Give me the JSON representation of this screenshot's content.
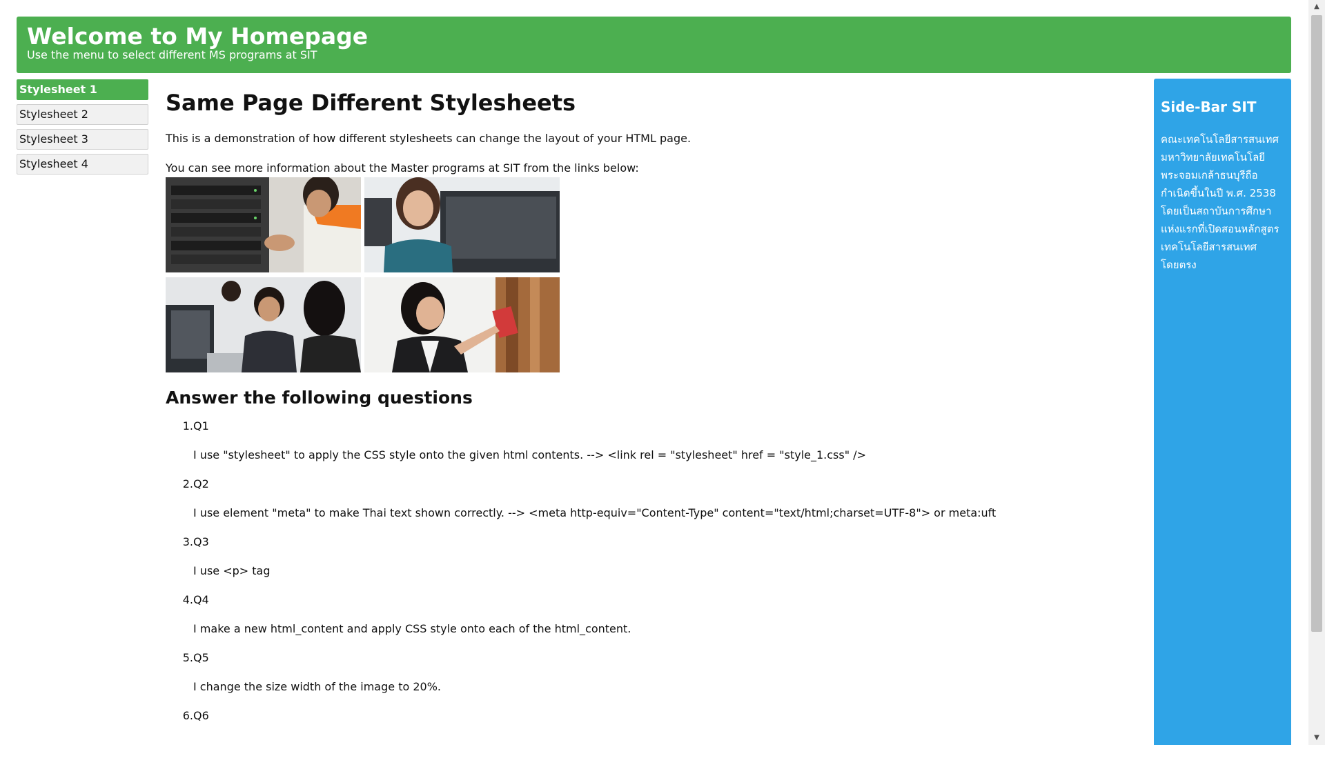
{
  "header": {
    "title": "Welcome to My Homepage",
    "subtitle": "Use the menu to select different MS programs at SIT"
  },
  "menu": {
    "items": [
      {
        "label": "Stylesheet 1",
        "active": true
      },
      {
        "label": "Stylesheet 2",
        "active": false
      },
      {
        "label": "Stylesheet 3",
        "active": false
      },
      {
        "label": "Stylesheet 4",
        "active": false
      }
    ]
  },
  "main": {
    "title": "Same Page Different Stylesheets",
    "intro": "This is a demonstration of how different stylesheets can change the layout of your HTML page.",
    "links_text": "You can see more information about the Master programs at SIT from the links below:",
    "gallery": [
      {
        "icon": "photo-server-technician-icon"
      },
      {
        "icon": "photo-woman-computer-icon"
      },
      {
        "icon": "photo-students-computer-lab-icon"
      },
      {
        "icon": "photo-woman-bookshelf-icon"
      }
    ],
    "questions_title": "Answer the following questions",
    "questions": [
      {
        "num": "1.",
        "q": "Q1",
        "a": "I use \"stylesheet\" to apply the CSS style onto the given html contents. --> <link rel = \"stylesheet\" href = \"style_1.css\" />"
      },
      {
        "num": "2.",
        "q": "Q2",
        "a": "I use element \"meta\" to make Thai text shown correctly. --> <meta http-equiv=\"Content-Type\" content=\"text/html;charset=UTF-8\"> or meta:uft"
      },
      {
        "num": "3.",
        "q": "Q3",
        "a": "I use <p> tag"
      },
      {
        "num": "4.",
        "q": "Q4",
        "a": "I make a new html_content and apply CSS style onto each of the html_content."
      },
      {
        "num": "5.",
        "q": "Q5",
        "a": "I change the size width of the image to 20%."
      },
      {
        "num": "6.",
        "q": "Q6",
        "a": ""
      }
    ]
  },
  "sidebar": {
    "title": "Side-Bar SIT",
    "text": "คณะเทคโนโลยีสารสนเทศ มหาวิทยาลัยเทคโนโลยีพระจอมเกล้าธนบุรีถือกำเนิดขึ้นในปี พ.ศ. 2538 โดยเป็นสถาบันการศึกษาแห่งแรกที่เปิดสอนหลักสูตรเทคโนโลยีสารสนเทศโดยตรง"
  },
  "colors": {
    "header_bg": "#4caf50",
    "sidebar_bg": "#2fa4e7",
    "menu_active_bg": "#4caf50"
  }
}
